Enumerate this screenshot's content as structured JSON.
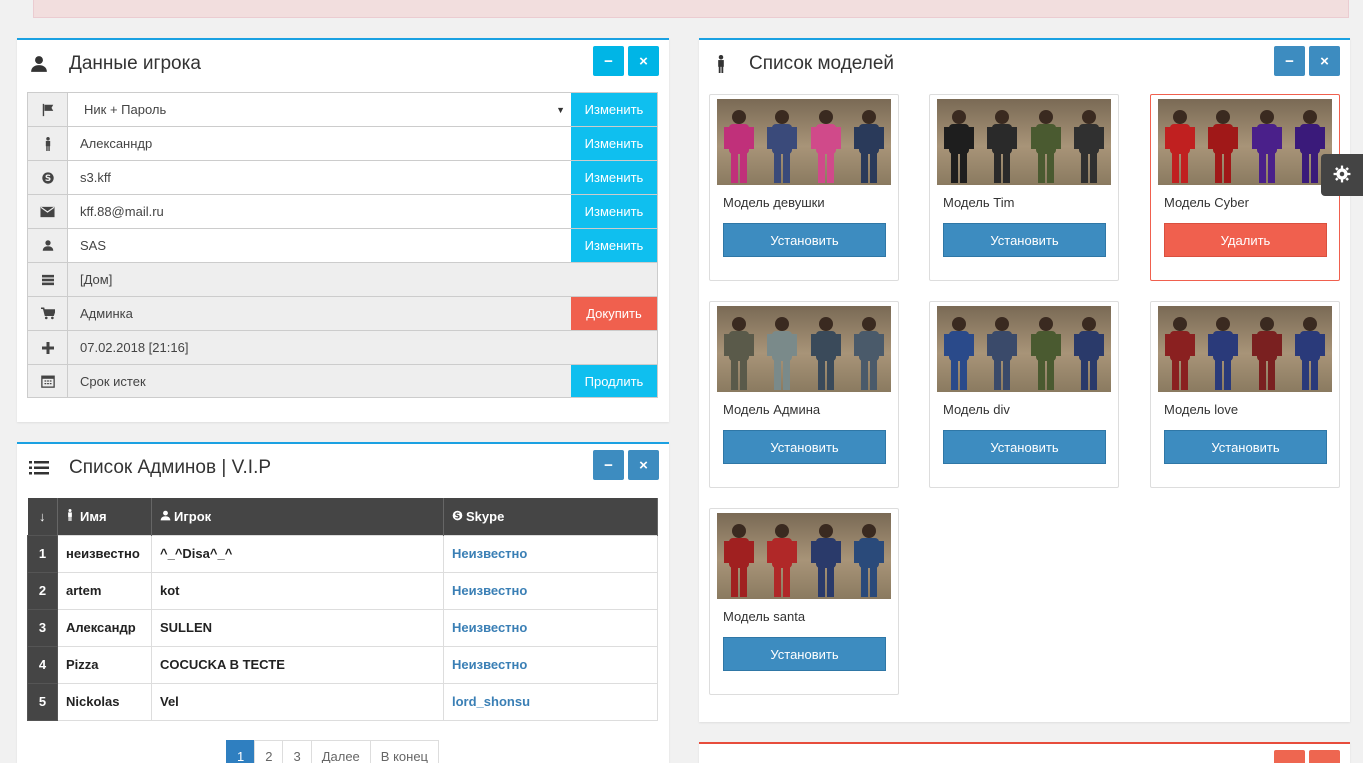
{
  "player_panel": {
    "title": "Данные игрока",
    "icon": "user-icon",
    "rows": [
      {
        "icon": "flag-icon",
        "value": "Ник + Пароль",
        "action": "Изменить",
        "type": "select"
      },
      {
        "icon": "male-icon",
        "value": "Алексанндр",
        "action": "Изменить",
        "type": "input"
      },
      {
        "icon": "skype-icon",
        "value": "s3.kff",
        "action": "Изменить",
        "type": "input"
      },
      {
        "icon": "envelope-icon",
        "value": "kff.88@mail.ru",
        "action": "Изменить",
        "type": "input"
      },
      {
        "icon": "user-icon",
        "value": "SAS",
        "action": "Изменить",
        "type": "input"
      },
      {
        "icon": "server-icon",
        "value": "[Дом]",
        "action": "",
        "type": "readonly"
      },
      {
        "icon": "cart-icon",
        "value": "Админка",
        "action": "Докупить",
        "type": "readonly"
      },
      {
        "icon": "plus-icon",
        "value": "07.02.2018 [21:16]",
        "action": "",
        "type": "readonly"
      },
      {
        "icon": "calendar-icon",
        "value": "Срок истек",
        "action": "Продлить",
        "type": "readonly"
      }
    ]
  },
  "admins_panel": {
    "title": "Список Админов | V.I.P",
    "headers": {
      "name": "Имя",
      "player": "Игрок",
      "skype": "Skype"
    },
    "rows": [
      {
        "num": "1",
        "name": "неизвестно",
        "player": "^_^Disa^_^",
        "skype": "Неизвестно"
      },
      {
        "num": "2",
        "name": "artem",
        "player": "kot",
        "skype": "Неизвестно"
      },
      {
        "num": "3",
        "name": "Александр",
        "player": "SULLEN",
        "skype": "Неизвестно"
      },
      {
        "num": "4",
        "name": "Pizza",
        "player": "COCUCKA В ТЕСТЕ",
        "skype": "Неизвестно"
      },
      {
        "num": "5",
        "name": "Nickolas",
        "player": "Vel",
        "skype": "lord_shonsu"
      }
    ],
    "pagination": {
      "pages": [
        "1",
        "2",
        "3"
      ],
      "next": "Далее",
      "last": "В конец",
      "active": "1"
    }
  },
  "models_panel": {
    "title": "Список моделей",
    "models": [
      {
        "name": "Модель девушки",
        "action": "Установить",
        "selected": false,
        "colors": [
          "#c0307a",
          "#3a4a7a",
          "#d04a8a",
          "#2a3a5a"
        ]
      },
      {
        "name": "Модель Tim",
        "action": "Установить",
        "selected": false,
        "colors": [
          "#1e1e1e",
          "#2a2a2a",
          "#4a5a30",
          "#303030"
        ]
      },
      {
        "name": "Модель Cyber",
        "action": "Удалить",
        "selected": true,
        "colors": [
          "#c02020",
          "#a01818",
          "#4a208a",
          "#3a1a7a"
        ]
      },
      {
        "name": "Модель Админа",
        "action": "Установить",
        "selected": false,
        "colors": [
          "#5a5a4a",
          "#7a8a8a",
          "#3a4a5a",
          "#4a5a6a"
        ]
      },
      {
        "name": "Модель div",
        "action": "Установить",
        "selected": false,
        "colors": [
          "#2a4a8a",
          "#3a4a6a",
          "#4a5a30",
          "#2a3a6a"
        ]
      },
      {
        "name": "Модель love",
        "action": "Установить",
        "selected": false,
        "colors": [
          "#8a2020",
          "#2a3a7a",
          "#7a2020",
          "#2a3a7a"
        ]
      },
      {
        "name": "Модель santa",
        "action": "Установить",
        "selected": false,
        "colors": [
          "#a02020",
          "#b02828",
          "#2a3a6a",
          "#2a4a7a"
        ]
      }
    ]
  },
  "tools": {
    "collapse": "−",
    "close": "×"
  },
  "colors": {
    "accent": "#1ba1e2",
    "steel": "#3d8cc0",
    "danger": "#f0604e",
    "cyan": "#0fbfef"
  }
}
